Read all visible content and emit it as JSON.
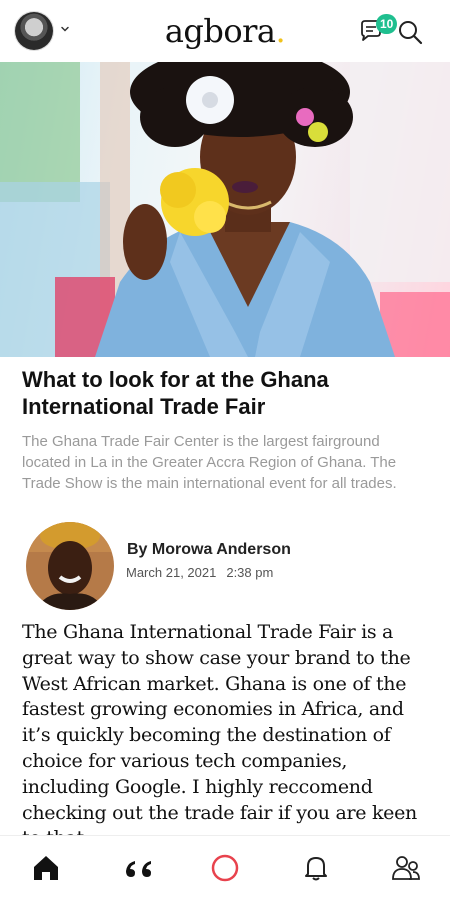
{
  "header": {
    "logo_text": "agbora",
    "logo_dot": ".",
    "messages_badge": "10",
    "avatar_icon": "profile-avatar",
    "chevron_icon": "chevron-down-icon",
    "messages_icon": "chat-bubble-icon",
    "search_icon": "search-icon"
  },
  "article": {
    "title": "What to look for at the Ghana International Trade Fair",
    "summary": "The Ghana Trade Fair Center is the largest fairground located in La in the Greater Accra Region of Ghana. The Trade Show is the main international event for all trades.",
    "author": {
      "name": "By Morowa Anderson",
      "date": "March 21, 2021",
      "time": "2:38 pm"
    },
    "body": "The Ghana International Trade Fair is a great way to show case your brand to the West African market. Ghana is one of the fastest growing economies in Africa, and it’s quickly becoming the destination of choice for various tech companies, including Google. I highly reccomend checking out the trade fair if you are keen to that"
  },
  "bottom_nav": [
    {
      "icon": "home-icon",
      "active": true
    },
    {
      "icon": "quote-icon",
      "active": false
    },
    {
      "icon": "record-circle-icon",
      "active": false
    },
    {
      "icon": "bell-icon",
      "active": false
    },
    {
      "icon": "people-icon",
      "active": false
    }
  ],
  "colors": {
    "accent_red": "#e8424d",
    "badge_green": "#1fbf8f",
    "logo_dot": "#f0c21b",
    "summary_gray": "#9a9a9a"
  }
}
